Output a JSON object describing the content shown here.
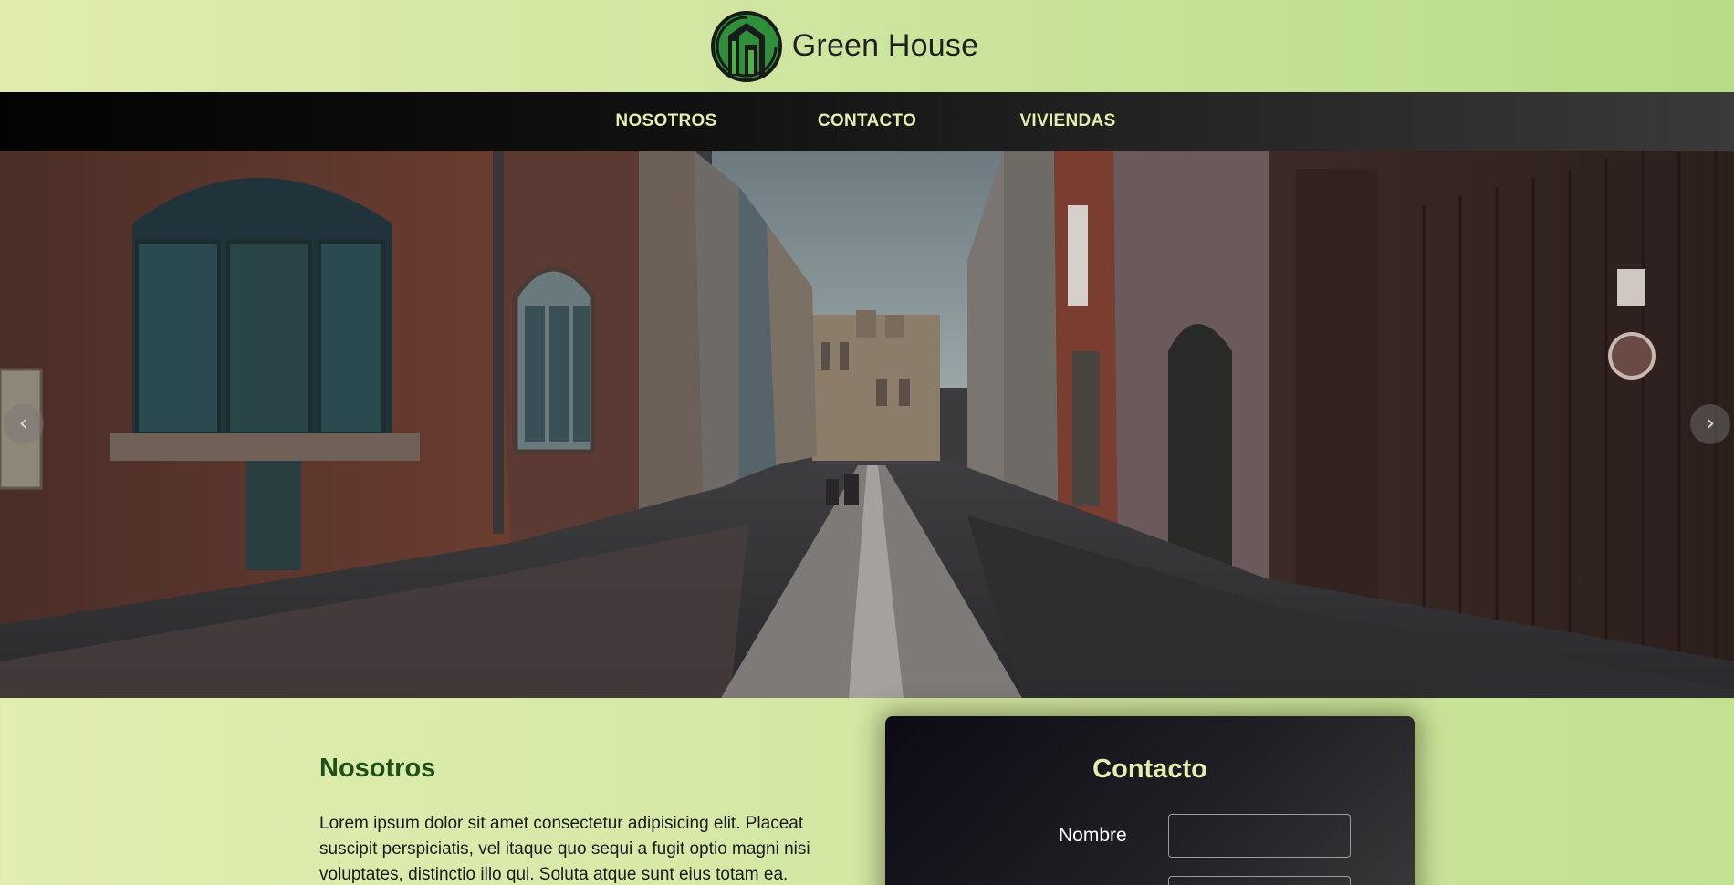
{
  "header": {
    "brand_name": "Green House",
    "logo_icon": "green-house-logo"
  },
  "nav": {
    "items": [
      {
        "label": "NOSOTROS"
      },
      {
        "label": "CONTACTO"
      },
      {
        "label": "VIVIENDAS"
      }
    ]
  },
  "hero": {
    "prev_icon": "‹",
    "next_icon": "›"
  },
  "about": {
    "title": "Nosotros",
    "text": "Lorem ipsum dolor sit amet consectetur adipisicing elit. Placeat suscipit perspiciatis, vel itaque quo sequi a fugit optio magni nisi voluptates, distinctio illo qui. Soluta atque sunt eius totam ea."
  },
  "contact": {
    "title": "Contacto",
    "name_label": "Nombre",
    "name_value": "",
    "second_value": ""
  },
  "colors": {
    "accent": "#e2efb0",
    "heading_green": "#1e4f15",
    "header_bg": "#d3e8a4",
    "nav_bg": "#111111"
  }
}
